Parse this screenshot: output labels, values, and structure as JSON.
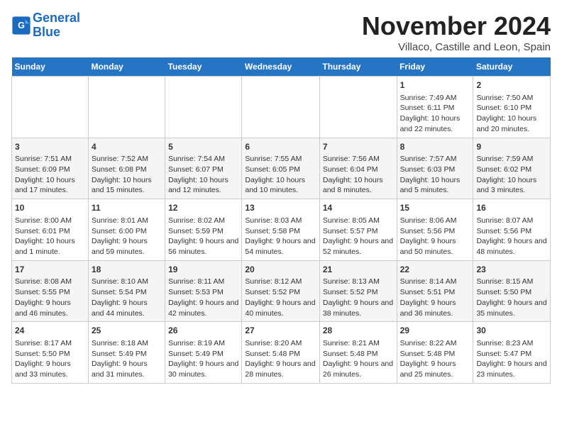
{
  "header": {
    "logo_line1": "General",
    "logo_line2": "Blue",
    "month": "November 2024",
    "location": "Villaco, Castille and Leon, Spain"
  },
  "weekdays": [
    "Sunday",
    "Monday",
    "Tuesday",
    "Wednesday",
    "Thursday",
    "Friday",
    "Saturday"
  ],
  "weeks": [
    [
      {
        "day": "",
        "info": ""
      },
      {
        "day": "",
        "info": ""
      },
      {
        "day": "",
        "info": ""
      },
      {
        "day": "",
        "info": ""
      },
      {
        "day": "",
        "info": ""
      },
      {
        "day": "1",
        "info": "Sunrise: 7:49 AM\nSunset: 6:11 PM\nDaylight: 10 hours and 22 minutes."
      },
      {
        "day": "2",
        "info": "Sunrise: 7:50 AM\nSunset: 6:10 PM\nDaylight: 10 hours and 20 minutes."
      }
    ],
    [
      {
        "day": "3",
        "info": "Sunrise: 7:51 AM\nSunset: 6:09 PM\nDaylight: 10 hours and 17 minutes."
      },
      {
        "day": "4",
        "info": "Sunrise: 7:52 AM\nSunset: 6:08 PM\nDaylight: 10 hours and 15 minutes."
      },
      {
        "day": "5",
        "info": "Sunrise: 7:54 AM\nSunset: 6:07 PM\nDaylight: 10 hours and 12 minutes."
      },
      {
        "day": "6",
        "info": "Sunrise: 7:55 AM\nSunset: 6:05 PM\nDaylight: 10 hours and 10 minutes."
      },
      {
        "day": "7",
        "info": "Sunrise: 7:56 AM\nSunset: 6:04 PM\nDaylight: 10 hours and 8 minutes."
      },
      {
        "day": "8",
        "info": "Sunrise: 7:57 AM\nSunset: 6:03 PM\nDaylight: 10 hours and 5 minutes."
      },
      {
        "day": "9",
        "info": "Sunrise: 7:59 AM\nSunset: 6:02 PM\nDaylight: 10 hours and 3 minutes."
      }
    ],
    [
      {
        "day": "10",
        "info": "Sunrise: 8:00 AM\nSunset: 6:01 PM\nDaylight: 10 hours and 1 minute."
      },
      {
        "day": "11",
        "info": "Sunrise: 8:01 AM\nSunset: 6:00 PM\nDaylight: 9 hours and 59 minutes."
      },
      {
        "day": "12",
        "info": "Sunrise: 8:02 AM\nSunset: 5:59 PM\nDaylight: 9 hours and 56 minutes."
      },
      {
        "day": "13",
        "info": "Sunrise: 8:03 AM\nSunset: 5:58 PM\nDaylight: 9 hours and 54 minutes."
      },
      {
        "day": "14",
        "info": "Sunrise: 8:05 AM\nSunset: 5:57 PM\nDaylight: 9 hours and 52 minutes."
      },
      {
        "day": "15",
        "info": "Sunrise: 8:06 AM\nSunset: 5:56 PM\nDaylight: 9 hours and 50 minutes."
      },
      {
        "day": "16",
        "info": "Sunrise: 8:07 AM\nSunset: 5:56 PM\nDaylight: 9 hours and 48 minutes."
      }
    ],
    [
      {
        "day": "17",
        "info": "Sunrise: 8:08 AM\nSunset: 5:55 PM\nDaylight: 9 hours and 46 minutes."
      },
      {
        "day": "18",
        "info": "Sunrise: 8:10 AM\nSunset: 5:54 PM\nDaylight: 9 hours and 44 minutes."
      },
      {
        "day": "19",
        "info": "Sunrise: 8:11 AM\nSunset: 5:53 PM\nDaylight: 9 hours and 42 minutes."
      },
      {
        "day": "20",
        "info": "Sunrise: 8:12 AM\nSunset: 5:52 PM\nDaylight: 9 hours and 40 minutes."
      },
      {
        "day": "21",
        "info": "Sunrise: 8:13 AM\nSunset: 5:52 PM\nDaylight: 9 hours and 38 minutes."
      },
      {
        "day": "22",
        "info": "Sunrise: 8:14 AM\nSunset: 5:51 PM\nDaylight: 9 hours and 36 minutes."
      },
      {
        "day": "23",
        "info": "Sunrise: 8:15 AM\nSunset: 5:50 PM\nDaylight: 9 hours and 35 minutes."
      }
    ],
    [
      {
        "day": "24",
        "info": "Sunrise: 8:17 AM\nSunset: 5:50 PM\nDaylight: 9 hours and 33 minutes."
      },
      {
        "day": "25",
        "info": "Sunrise: 8:18 AM\nSunset: 5:49 PM\nDaylight: 9 hours and 31 minutes."
      },
      {
        "day": "26",
        "info": "Sunrise: 8:19 AM\nSunset: 5:49 PM\nDaylight: 9 hours and 30 minutes."
      },
      {
        "day": "27",
        "info": "Sunrise: 8:20 AM\nSunset: 5:48 PM\nDaylight: 9 hours and 28 minutes."
      },
      {
        "day": "28",
        "info": "Sunrise: 8:21 AM\nSunset: 5:48 PM\nDaylight: 9 hours and 26 minutes."
      },
      {
        "day": "29",
        "info": "Sunrise: 8:22 AM\nSunset: 5:48 PM\nDaylight: 9 hours and 25 minutes."
      },
      {
        "day": "30",
        "info": "Sunrise: 8:23 AM\nSunset: 5:47 PM\nDaylight: 9 hours and 23 minutes."
      }
    ]
  ]
}
